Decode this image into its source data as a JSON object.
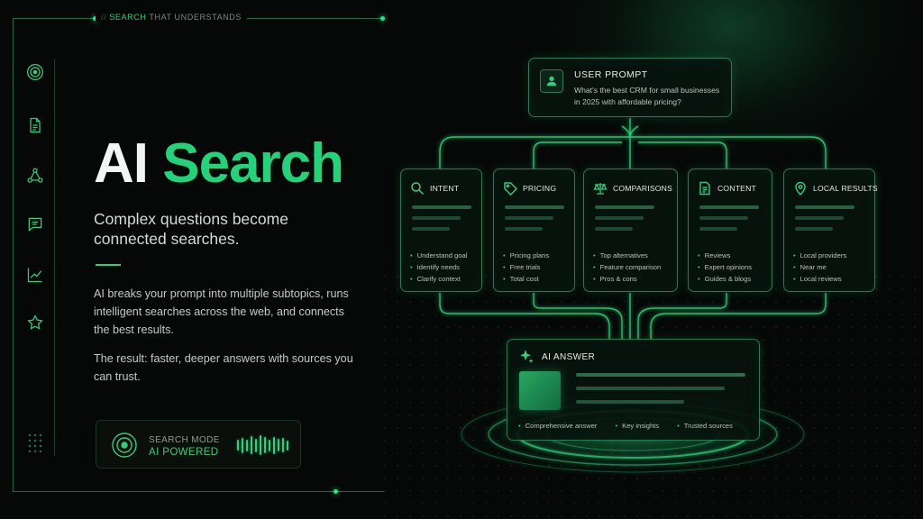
{
  "tagline": {
    "prefix": "//",
    "highlight": "SEARCH",
    "rest": "THAT UNDERSTANDS"
  },
  "sidebar": {
    "icons": [
      "target-icon",
      "document-icon",
      "network-icon",
      "chat-icon",
      "chart-icon",
      "star-icon"
    ]
  },
  "hero": {
    "title_word1": "AI",
    "title_word2": "Search",
    "subtitle": "Complex questions become connected searches.",
    "paragraph1": "AI breaks your prompt into multiple subtopics, runs intelligent searches across the web, and connects the best results.",
    "paragraph2": "The result: faster, deeper answers with sources you can trust."
  },
  "mode": {
    "label": "SEARCH MODE",
    "value": "AI POWERED",
    "wave_levels": [
      0.45,
      0.7,
      0.5,
      0.9,
      0.6,
      1.0,
      0.75,
      0.5,
      0.85,
      0.55,
      0.65,
      0.4
    ]
  },
  "prompt": {
    "title": "USER PROMPT",
    "text": "What's the best CRM for small businesses in 2025 with affordable pricing?"
  },
  "topics": [
    {
      "label": "INTENT",
      "icon": "search-icon",
      "items": [
        "Understand goal",
        "Identify needs",
        "Clarify context"
      ]
    },
    {
      "label": "PRICING",
      "icon": "price-tag-icon",
      "items": [
        "Pricing plans",
        "Free trials",
        "Total cost"
      ]
    },
    {
      "label": "COMPARISONS",
      "icon": "scales-icon",
      "items": [
        "Top alternatives",
        "Feature comparison",
        "Pros & cons"
      ]
    },
    {
      "label": "CONTENT",
      "icon": "document-icon",
      "items": [
        "Reviews",
        "Expert opinions",
        "Guides & blogs"
      ]
    },
    {
      "label": "LOCAL RESULTS",
      "icon": "location-pin-icon",
      "items": [
        "Local providers",
        "Near me",
        "Local reviews"
      ]
    }
  ],
  "answer": {
    "title": "AI ANSWER",
    "icon": "sparkle-icon",
    "features": [
      "Comprehensive answer",
      "Key insights",
      "Trusted sources"
    ]
  },
  "colors": {
    "accent": "#22d37a",
    "background": "#050807",
    "card_border": "#2a7a52"
  }
}
